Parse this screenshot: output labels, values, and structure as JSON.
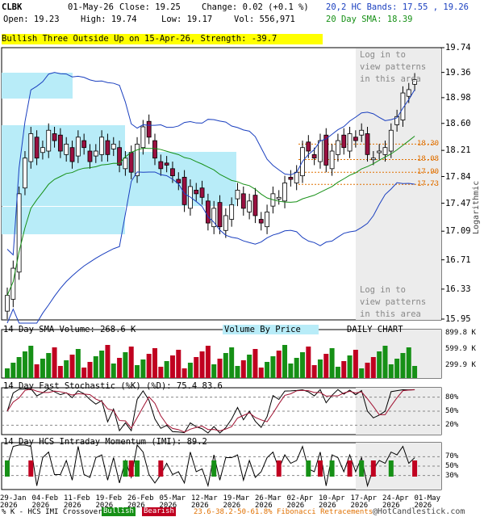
{
  "header": {
    "symbol": "CLBK",
    "date": "01-May-26",
    "close_label": "Close: 19.25",
    "change_label": "Change: 0.02 (+0.1 %)",
    "open_label": "Open: 19.23",
    "high_label": "High: 19.74",
    "low_label": "Low: 19.17",
    "vol_label": "Vol: 556,971",
    "hc_bands_label": "20,2 HC Bands: 17.55 , 19.26",
    "sma_label": "20 Day SMA: 18.39"
  },
  "banner": "Bullish Three Outside Up on 15-Apr-26, Strength: -39.7",
  "login_text": [
    "Log in to",
    "view patterns",
    "in this area"
  ],
  "side_label": "Logarithmic",
  "chart_data": [
    {
      "type": "candlestick",
      "yscale": "log",
      "ylim": [
        15.95,
        19.74
      ],
      "y_ticks": [
        "19.74",
        "19.36",
        "18.98",
        "18.60",
        "18.21",
        "17.84",
        "17.47",
        "17.09",
        "16.71",
        "16.33",
        "15.95"
      ],
      "fib_levels": [
        "18.30",
        "18.08",
        "17.90",
        "17.73"
      ],
      "x_labels": [
        {
          "top": "29-Jan",
          "bottom": "2026"
        },
        {
          "top": "04-Feb",
          "bottom": "2026"
        },
        {
          "top": "11-Feb",
          "bottom": "2026"
        },
        {
          "top": "19-Feb",
          "bottom": "2026"
        },
        {
          "top": "26-Feb",
          "bottom": "2026"
        },
        {
          "top": "05-Mar",
          "bottom": "2026"
        },
        {
          "top": "12-Mar",
          "bottom": "2026"
        },
        {
          "top": "19-Mar",
          "bottom": "2026"
        },
        {
          "top": "26-Mar",
          "bottom": "2026"
        },
        {
          "top": "02-Apr",
          "bottom": "2026"
        },
        {
          "top": "10-Apr",
          "bottom": "2026"
        },
        {
          "top": "17-Apr",
          "bottom": "2026"
        },
        {
          "top": "24-Apr",
          "bottom": "2026"
        },
        {
          "top": "01-May",
          "bottom": "2026"
        }
      ],
      "closes": [
        16.25,
        16.6,
        17.6,
        18.1,
        18.45,
        18.1,
        18.25,
        18.5,
        18.35,
        18.2,
        18.3,
        18.05,
        18.4,
        18.25,
        18.05,
        18.2,
        18.4,
        18.15,
        18.3,
        18.0,
        18.1,
        17.9,
        18.3,
        18.55,
        18.4,
        18.1,
        17.95,
        18.0,
        17.85,
        17.75,
        17.45,
        17.7,
        17.6,
        17.55,
        17.2,
        17.4,
        17.15,
        17.3,
        17.45,
        17.65,
        17.4,
        17.5,
        17.3,
        17.2,
        17.35,
        17.6,
        17.55,
        17.75,
        17.8,
        17.9,
        18.25,
        18.2,
        18.1,
        18.35,
        18.0,
        18.2,
        18.35,
        18.25,
        18.45,
        18.35,
        18.5,
        18.15,
        18.1,
        18.2,
        18.25,
        18.5,
        18.7,
        19.05,
        19.1,
        19.25
      ],
      "sma_volume_label": "14 Day SMA Volume: 268.6 K",
      "volume_by_price_label": "Volume By Price",
      "daily_chart_label": "DAILY CHART"
    },
    {
      "type": "bar",
      "name": "volume",
      "y_ticks": [
        "899.8 K",
        "599.9 K",
        "299.9 K"
      ],
      "ylim": [
        0,
        899.8
      ]
    },
    {
      "type": "line",
      "title": "14 Day Fast Stochastic (%K) (%D): 75.4   83.6",
      "y_ticks": [
        "80%",
        "50%",
        "20%"
      ],
      "ylim": [
        0,
        100
      ]
    },
    {
      "type": "bar",
      "title": "14 Day HCS Intraday Momentum (IMI): 89.2",
      "y_ticks": [
        "70%",
        "50%",
        "30%"
      ],
      "ylim": [
        0,
        100
      ]
    }
  ],
  "footer": {
    "legend_prefix": "% K - HCS IMI Crossover,",
    "bullish": "Bullish",
    "bearish": "Bearish",
    "fib": "23.6-38.2-50-61.8% Fibonacci Retracements",
    "copyright": "@HotCandlestick.com"
  },
  "colors": {
    "up": "#169016",
    "down": "#c00020",
    "band": "#1a3fbf",
    "sma": "#169016",
    "vbp": "#b8ecf8"
  }
}
